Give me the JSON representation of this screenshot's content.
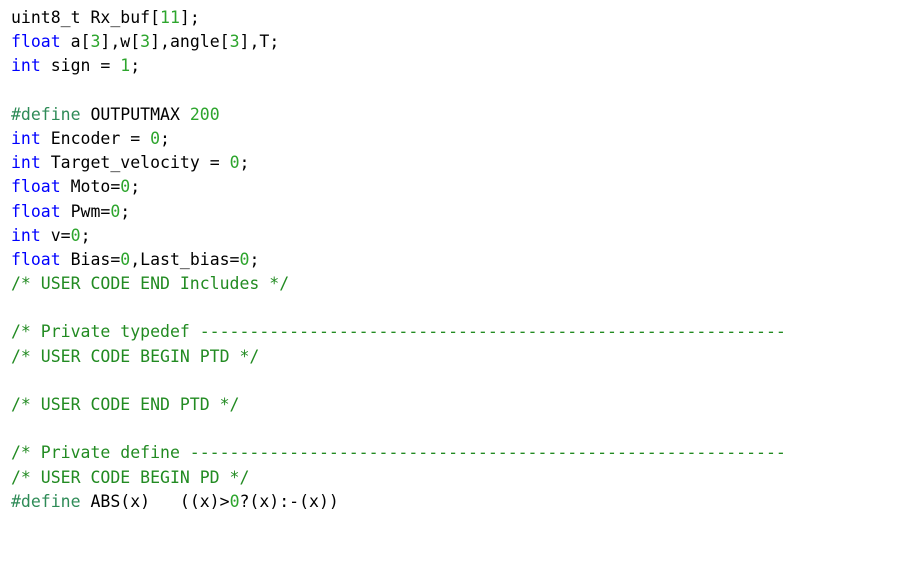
{
  "lines": [
    [
      {
        "t": "plain",
        "s": "uint8_t Rx_buf["
      },
      {
        "t": "num",
        "s": "11"
      },
      {
        "t": "plain",
        "s": "];"
      }
    ],
    [
      {
        "t": "kw",
        "s": "float"
      },
      {
        "t": "plain",
        "s": " a["
      },
      {
        "t": "num",
        "s": "3"
      },
      {
        "t": "plain",
        "s": "],w["
      },
      {
        "t": "num",
        "s": "3"
      },
      {
        "t": "plain",
        "s": "],angle["
      },
      {
        "t": "num",
        "s": "3"
      },
      {
        "t": "plain",
        "s": "],T;"
      }
    ],
    [
      {
        "t": "kw",
        "s": "int"
      },
      {
        "t": "plain",
        "s": " sign = "
      },
      {
        "t": "num",
        "s": "1"
      },
      {
        "t": "plain",
        "s": ";"
      }
    ],
    [],
    [
      {
        "t": "pre",
        "s": "#define"
      },
      {
        "t": "plain",
        "s": " OUTPUTMAX "
      },
      {
        "t": "num",
        "s": "200"
      }
    ],
    [
      {
        "t": "kw",
        "s": "int"
      },
      {
        "t": "plain",
        "s": " Encoder = "
      },
      {
        "t": "num",
        "s": "0"
      },
      {
        "t": "plain",
        "s": ";"
      }
    ],
    [
      {
        "t": "kw",
        "s": "int"
      },
      {
        "t": "plain",
        "s": " Target_velocity = "
      },
      {
        "t": "num",
        "s": "0"
      },
      {
        "t": "plain",
        "s": ";"
      }
    ],
    [
      {
        "t": "kw",
        "s": "float"
      },
      {
        "t": "plain",
        "s": " Moto="
      },
      {
        "t": "num",
        "s": "0"
      },
      {
        "t": "plain",
        "s": ";"
      }
    ],
    [
      {
        "t": "kw",
        "s": "float"
      },
      {
        "t": "plain",
        "s": " Pwm="
      },
      {
        "t": "num",
        "s": "0"
      },
      {
        "t": "plain",
        "s": ";"
      }
    ],
    [
      {
        "t": "kw",
        "s": "int"
      },
      {
        "t": "plain",
        "s": " v="
      },
      {
        "t": "num",
        "s": "0"
      },
      {
        "t": "plain",
        "s": ";"
      }
    ],
    [
      {
        "t": "kw",
        "s": "float"
      },
      {
        "t": "plain",
        "s": " Bias="
      },
      {
        "t": "num",
        "s": "0"
      },
      {
        "t": "plain",
        "s": ",Last_bias="
      },
      {
        "t": "num",
        "s": "0"
      },
      {
        "t": "plain",
        "s": ";"
      }
    ],
    [
      {
        "t": "com",
        "s": "/* USER CODE END Includes */"
      }
    ],
    [],
    [
      {
        "t": "com",
        "s": "/* Private typedef -----------------------------------------------------------"
      }
    ],
    [
      {
        "t": "com",
        "s": "/* USER CODE BEGIN PTD */"
      }
    ],
    [],
    [
      {
        "t": "com",
        "s": "/* USER CODE END PTD */"
      }
    ],
    [],
    [
      {
        "t": "com",
        "s": "/* Private define ------------------------------------------------------------"
      }
    ],
    [
      {
        "t": "com",
        "s": "/* USER CODE BEGIN PD */"
      }
    ],
    [
      {
        "t": "pre",
        "s": "#define"
      },
      {
        "t": "plain",
        "s": " ABS(x)   ((x)>"
      },
      {
        "t": "num",
        "s": "0"
      },
      {
        "t": "plain",
        "s": "?(x):-(x))"
      }
    ]
  ],
  "colors": {
    "plain": "#000000",
    "keyword": "#0000ff",
    "number": "#2da52d",
    "preprocessor": "#2e8b57",
    "comment": "#228b22",
    "background": "#ffffff"
  }
}
